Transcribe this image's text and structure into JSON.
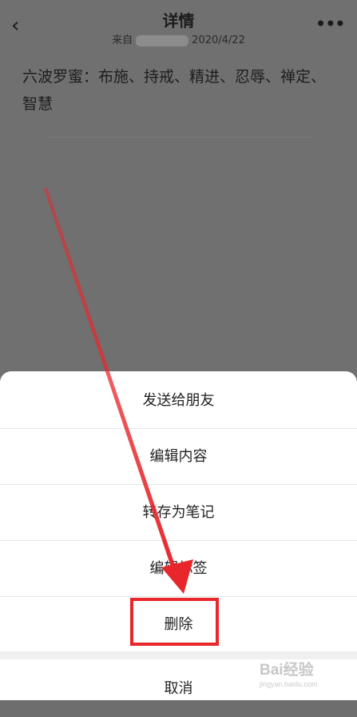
{
  "header": {
    "title": "详情",
    "from_label": "来自",
    "date": "2020/4/22"
  },
  "note": {
    "text": "六波罗蜜：布施、持戒、精进、忍辱、禅定、智慧"
  },
  "sheet": {
    "items": [
      {
        "label": "发送给朋友"
      },
      {
        "label": "编辑内容"
      },
      {
        "label": "转存为笔记"
      },
      {
        "label": "编辑标签"
      },
      {
        "label": "删除"
      }
    ],
    "cancel": "取消"
  },
  "annotation": {
    "arrow_color": "#e8272c",
    "highlight_target": "删除"
  },
  "watermark": {
    "main": "Bai经验",
    "sub": "jingyan.baidu.com"
  }
}
